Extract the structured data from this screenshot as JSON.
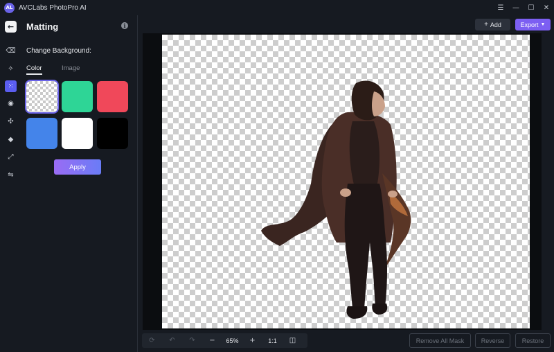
{
  "window": {
    "logo_text": "AL",
    "title": "AVCLabs PhotoPro AI",
    "menu_icon": "hamburger-icon",
    "minimize_icon": "minimize-icon",
    "maximize_icon": "maximize-icon",
    "close_icon": "close-icon"
  },
  "toolbar": {
    "add_label": "Add",
    "export_label": "Export"
  },
  "panel": {
    "title": "Matting",
    "section_label": "Change Background:",
    "tabs": [
      {
        "label": "Color",
        "active": true
      },
      {
        "label": "Image",
        "active": false
      }
    ],
    "swatches": [
      {
        "name": "transparent",
        "color": "transparent",
        "selected": true
      },
      {
        "name": "green",
        "color": "#2ed596",
        "selected": false
      },
      {
        "name": "red",
        "color": "#f0485a",
        "selected": false
      },
      {
        "name": "blue",
        "color": "#4484ea",
        "selected": false
      },
      {
        "name": "white",
        "color": "#ffffff",
        "selected": false
      },
      {
        "name": "black",
        "color": "#000000",
        "selected": false
      }
    ],
    "apply_label": "Apply"
  },
  "sidebar_icons": [
    "back-arrow-icon",
    "eraser-icon",
    "enhance-icon",
    "matting-icon",
    "portrait-icon",
    "object-removal-icon",
    "colorize-icon",
    "upscale-icon",
    "adjust-icon"
  ],
  "bottom": {
    "zoom": "65%",
    "ratio": "1:1",
    "remove_all_mask_label": "Remove All Mask",
    "reverse_label": "Reverse",
    "restore_label": "Restore"
  },
  "colors": {
    "accent": "#6a63e8",
    "export": "#7c5ff2",
    "background": "#161a21"
  }
}
